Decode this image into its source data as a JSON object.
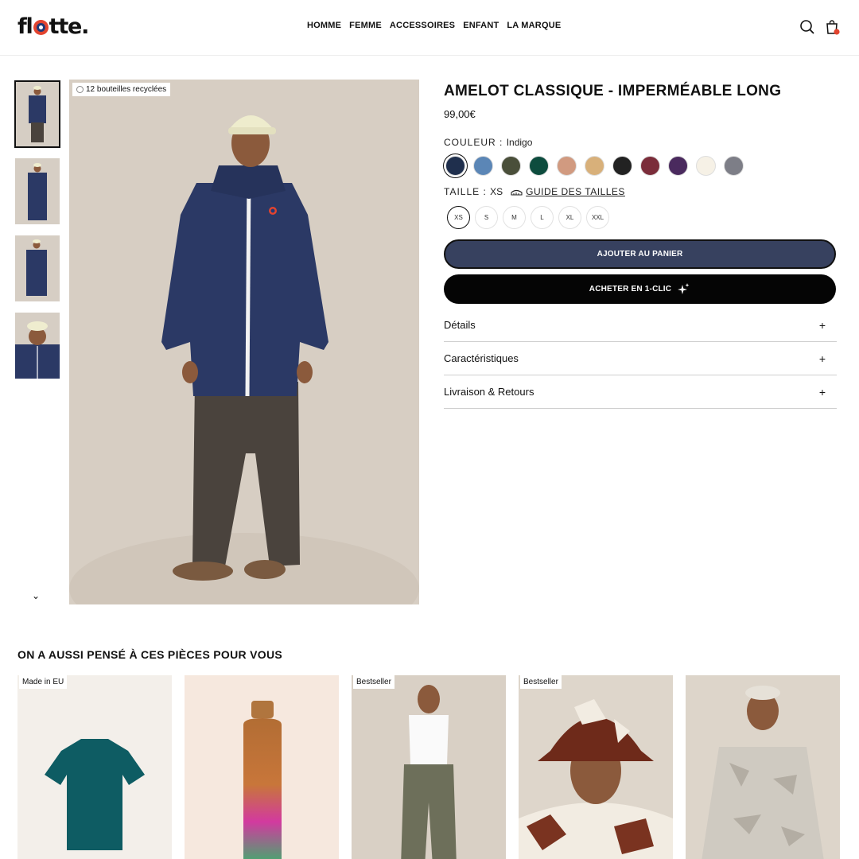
{
  "header": {
    "logo": "flotte.",
    "nav": [
      "HOMME",
      "FEMME",
      "ACCESSOIRES",
      "ENFANT",
      "LA MARQUE"
    ],
    "icons": [
      "search-icon",
      "cart-icon"
    ]
  },
  "gallery": {
    "badge": "12 bouteilles recyclées",
    "thumb_count": 4
  },
  "product": {
    "title": "AMELOT CLASSIQUE - IMPERMÉABLE LONG",
    "price": "99,00€",
    "color_label": "COULEUR :",
    "color_value": "Indigo",
    "colors": [
      "#1f2f4d",
      "#5b86b6",
      "#4a4f3a",
      "#0d4c3e",
      "#d19a80",
      "#d8b07a",
      "#222222",
      "#7b2d3a",
      "#4a2a5e",
      "#f6f1e6",
      "#7d7e87"
    ],
    "selected_color_index": 0,
    "size_label": "TAILLE :",
    "size_value": "XS",
    "size_guide": "GUIDE DES TAILLES",
    "sizes": [
      "XS",
      "S",
      "M",
      "L",
      "XL",
      "XXL"
    ],
    "selected_size_index": 0,
    "add_to_cart": "AJOUTER AU PANIER",
    "buy_one_click": "ACHETER EN 1-CLIC",
    "accordions": [
      "Détails",
      "Caractéristiques",
      "Livraison & Retours"
    ],
    "accordion_icon": "+"
  },
  "recommendations": {
    "title": "ON A AUSSI PENSÉ À CES PIÈCES POUR VOUS",
    "cards": [
      {
        "badge": "Made in EU"
      },
      {
        "badge": ""
      },
      {
        "badge": "Bestseller"
      },
      {
        "badge": "Bestseller"
      },
      {
        "badge": ""
      }
    ]
  },
  "colors": {
    "cart_button": "#37415f",
    "buy_button": "#050505",
    "cart_dot": "#e2442f"
  }
}
